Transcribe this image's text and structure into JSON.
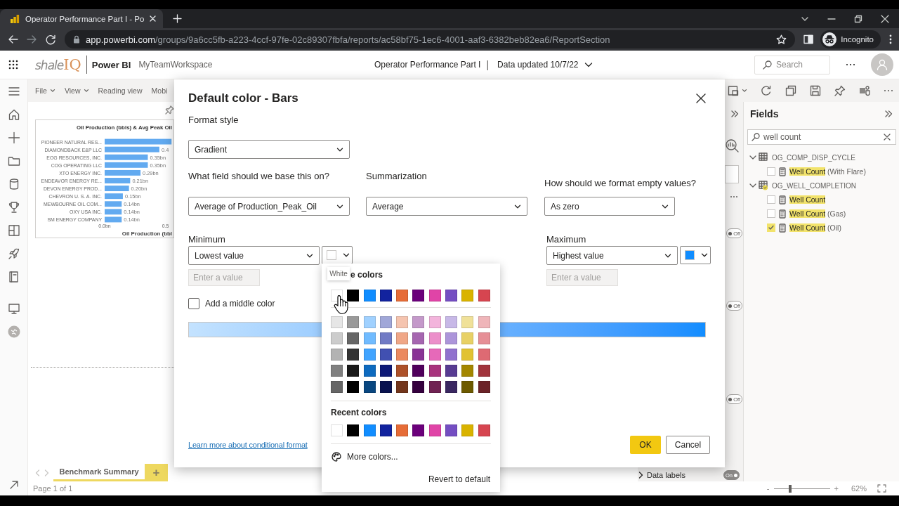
{
  "browser": {
    "tab_title": "Operator Performance Part I - Po",
    "url_host": "app.powerbi.com",
    "url_path": "/groups/9a6cc5fb-a223-4ccf-97fe-02c89307fbfa/reports/ac58bf75-1ec6-4001-aaf3-6382beb82ea6/ReportSection",
    "profile": "Incognito"
  },
  "header": {
    "logo_a": "shale",
    "logo_b": "IQ",
    "product": "Power BI",
    "workspace": "MyTeamWorkspace",
    "report_title": "Operator Performance Part I",
    "separator": "|",
    "data_updated": "Data updated 10/7/22",
    "search_placeholder": "Search"
  },
  "toolbar": {
    "menus": [
      {
        "label": "File",
        "dropdown": true
      },
      {
        "label": "View",
        "dropdown": true
      },
      {
        "label": "Reading view",
        "dropdown": false
      },
      {
        "label": "Mobi",
        "dropdown": false
      }
    ]
  },
  "canvas": {
    "chart": {
      "chart_data": {
        "type": "bar",
        "orientation": "horizontal",
        "title": "Oil Production (bbls) & Avg Peak Oil",
        "xlabel": "Oil Production (bbl",
        "categories": [
          "PIONEER NATURAL RES...",
          "DIAMONDBACK E&P LLC",
          "EOG RESOURCES, INC.",
          "COG OPERATING LLC",
          "XTO ENERGY INC.",
          "ENDEAVOR ENERGY RE...",
          "DEVON ENERGY PROD...",
          "CHEVRON U. S. A. INC.",
          "MEWBOURNE OIL COM...",
          "OXY USA INC.",
          "SM ENERGY COMPANY"
        ],
        "values": [
          0.55,
          0.45,
          0.355,
          0.355,
          0.295,
          0.21,
          0.2,
          0.15,
          0.14,
          0.14,
          0.14
        ],
        "value_labels": [
          null,
          "0.4",
          "0.35bn",
          "0.35bn",
          "0.29bn",
          "0.21bn",
          "0.20bn",
          "0.15bn",
          "0.14bn",
          "0.14bn",
          "0.14bn"
        ],
        "xlim": [
          0,
          0.56
        ],
        "xticks": [
          {
            "value": 0,
            "label": "0.0bn"
          },
          {
            "value": 0.5,
            "label": "0.5"
          }
        ]
      }
    }
  },
  "pages": {
    "tabs": [
      {
        "label": "Benchmark Summary",
        "selected": true
      }
    ],
    "add": "+",
    "page_info": "Page 1 of 1"
  },
  "format_pane": {
    "toggles": [
      {
        "text": "Off",
        "on": false
      },
      {
        "text": "Off",
        "on": false
      },
      {
        "text": "Off",
        "on": false
      }
    ],
    "data_labels": {
      "label": "Data labels",
      "toggle": {
        "text": "On",
        "on": true
      }
    }
  },
  "fields_pane": {
    "title": "Fields",
    "search_value": "well count",
    "tables": [
      {
        "name": "OG_COMP_DISP_CYCLE",
        "expanded": true,
        "has_selection": false,
        "children": [
          {
            "highlight": "Well Count",
            "rest": " (With Flare)",
            "checked": false
          }
        ]
      },
      {
        "name": "OG_WELL_COMPLETION",
        "expanded": true,
        "has_selection": true,
        "children": [
          {
            "highlight": "Well Count",
            "checked": false
          },
          {
            "highlight": "Well Count",
            "rest": " (Gas)",
            "checked": false
          },
          {
            "highlight": "Well Count",
            "rest": " (Oil)",
            "checked": true
          }
        ]
      }
    ]
  },
  "zoom": {
    "minus": "-",
    "plus": "+",
    "level": 0.29,
    "reading": "62%"
  },
  "dialog": {
    "title": "Default color - Bars",
    "format_style": {
      "label": "Format style",
      "value": "Gradient"
    },
    "based_on": {
      "label": "What field should we base this on?",
      "value": "Average of Production_Peak_Oil"
    },
    "summarization": {
      "label": "Summarization",
      "value": "Average"
    },
    "empty_values": {
      "label": "How should we format empty values?",
      "value": "As zero"
    },
    "minimum": {
      "label": "Minimum",
      "value": "Lowest value",
      "color": "#ffffff",
      "placeholder": "Enter a value"
    },
    "maximum": {
      "label": "Maximum",
      "value": "Highest value",
      "color": "#118dff",
      "placeholder": "Enter a value"
    },
    "middle_color": {
      "label": "Add a middle color",
      "checked": false
    },
    "link": "Learn more about conditional format",
    "ok": "OK",
    "cancel": "Cancel"
  },
  "color_picker": {
    "tooltip": "White",
    "theme_heading": "e colors",
    "theme": [
      {
        "color": "#ffffff"
      },
      {
        "color": "#000000"
      },
      {
        "color": "#118dff"
      },
      {
        "color": "#12239e"
      },
      {
        "color": "#e66c37"
      },
      {
        "color": "#6b007b"
      },
      {
        "color": "#e044a7"
      },
      {
        "color": "#744ec2"
      },
      {
        "color": "#d9b300"
      },
      {
        "color": "#d64550"
      }
    ],
    "shades": [
      [
        {
          "color": "#e6e6e6"
        },
        {
          "color": "#999999"
        },
        {
          "color": "#a0d1ff"
        },
        {
          "color": "#a0a7d8"
        },
        {
          "color": "#f5c4af"
        },
        {
          "color": "#c499ca"
        },
        {
          "color": "#f3b4dc"
        },
        {
          "color": "#c7b8e7"
        },
        {
          "color": "#f0e199"
        },
        {
          "color": "#efb5b9"
        }
      ],
      [
        {
          "color": "#cccccc"
        },
        {
          "color": "#666666"
        },
        {
          "color": "#70bbff"
        },
        {
          "color": "#717bc5"
        },
        {
          "color": "#f0a787"
        },
        {
          "color": "#a666b0"
        },
        {
          "color": "#ec8fca"
        },
        {
          "color": "#ac95da"
        },
        {
          "color": "#e8d166"
        },
        {
          "color": "#e68f96"
        }
      ],
      [
        {
          "color": "#b3b3b3"
        },
        {
          "color": "#333333"
        },
        {
          "color": "#41a4ff"
        },
        {
          "color": "#4150b1"
        },
        {
          "color": "#eb895f"
        },
        {
          "color": "#893395"
        },
        {
          "color": "#e669b9"
        },
        {
          "color": "#9071ce"
        },
        {
          "color": "#e1c233"
        },
        {
          "color": "#de6a73"
        }
      ],
      [
        {
          "color": "#808080"
        },
        {
          "color": "#1a1a1a"
        },
        {
          "color": "#0d6abf"
        },
        {
          "color": "#0e1a77"
        },
        {
          "color": "#ad5129"
        },
        {
          "color": "#50005c"
        },
        {
          "color": "#a8337d"
        },
        {
          "color": "#573b92"
        },
        {
          "color": "#a38600"
        },
        {
          "color": "#a1343c"
        }
      ],
      [
        {
          "color": "#666666"
        },
        {
          "color": "#000000"
        },
        {
          "color": "#094780"
        },
        {
          "color": "#09124f"
        },
        {
          "color": "#73361c"
        },
        {
          "color": "#35003e"
        },
        {
          "color": "#702253"
        },
        {
          "color": "#3a2761"
        },
        {
          "color": "#6d5a00"
        },
        {
          "color": "#6b2328"
        }
      ]
    ],
    "recent_heading": "Recent colors",
    "recent": [
      {
        "color": "#ffffff"
      },
      {
        "color": "#000000"
      },
      {
        "color": "#118dff"
      },
      {
        "color": "#12239e"
      },
      {
        "color": "#e66c37"
      },
      {
        "color": "#6b007b"
      },
      {
        "color": "#e044a7"
      },
      {
        "color": "#744ec2"
      },
      {
        "color": "#d9b300"
      },
      {
        "color": "#d64550"
      }
    ],
    "more": "More colors...",
    "revert": "Revert to default"
  }
}
